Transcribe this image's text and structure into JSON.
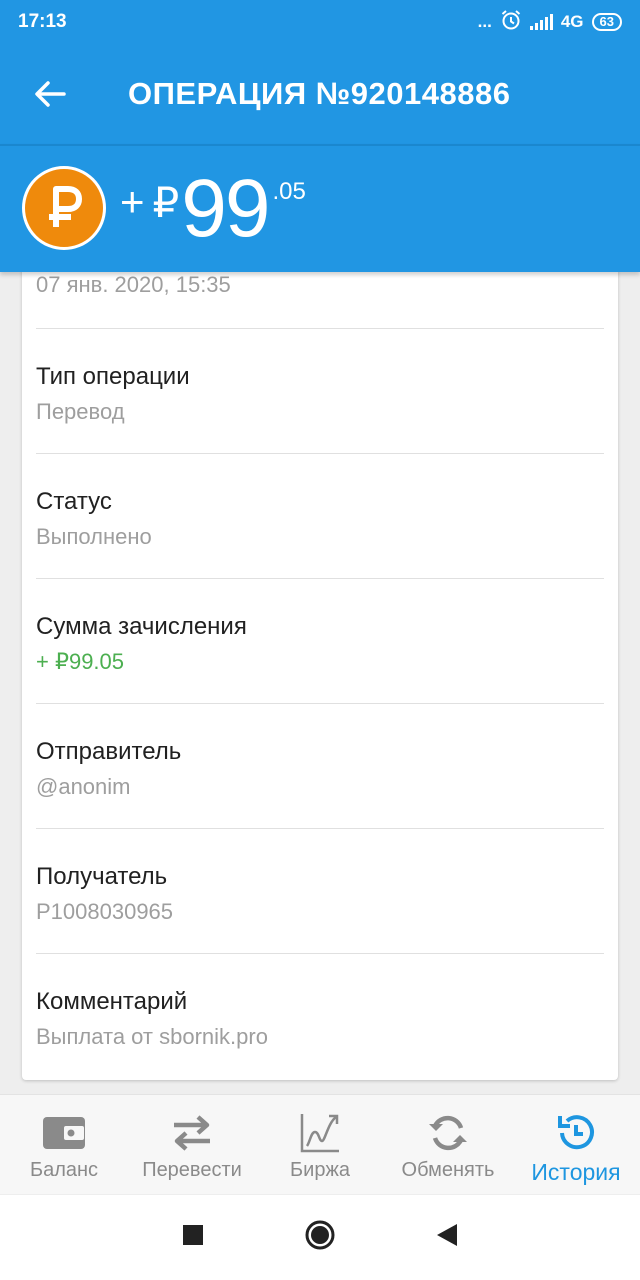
{
  "status_bar": {
    "time": "17:13",
    "dots": "...",
    "network": "4G",
    "battery": "63"
  },
  "app_bar": {
    "title": "ОПЕРАЦИЯ №920148886"
  },
  "amount": {
    "sign": "+",
    "currency": "₽",
    "integer": "99",
    "fraction": ".05"
  },
  "details": {
    "date": "07 янв. 2020, 15:35",
    "rows": [
      {
        "label": "Тип операции",
        "value": "Перевод"
      },
      {
        "label": "Статус",
        "value": "Выполнено"
      },
      {
        "label": "Сумма зачисления",
        "value": "+ ₽99.05"
      },
      {
        "label": "Отправитель",
        "value": "@anonim"
      },
      {
        "label": "Получатель",
        "value": "P1008030965"
      },
      {
        "label": "Комментарий",
        "value": "Выплата от sbornik.pro"
      }
    ]
  },
  "bottom_nav": {
    "items": [
      {
        "label": "Баланс",
        "icon": "wallet-icon"
      },
      {
        "label": "Перевести",
        "icon": "transfer-arrows-icon"
      },
      {
        "label": "Биржа",
        "icon": "chart-icon"
      },
      {
        "label": "Обменять",
        "icon": "refresh-icon"
      },
      {
        "label": "История",
        "icon": "history-icon",
        "active": true
      }
    ]
  },
  "colors": {
    "primary": "#2196e3",
    "coin": "#ef8a0c",
    "positive": "#4caf50",
    "active_nav": "#1e96e0"
  }
}
